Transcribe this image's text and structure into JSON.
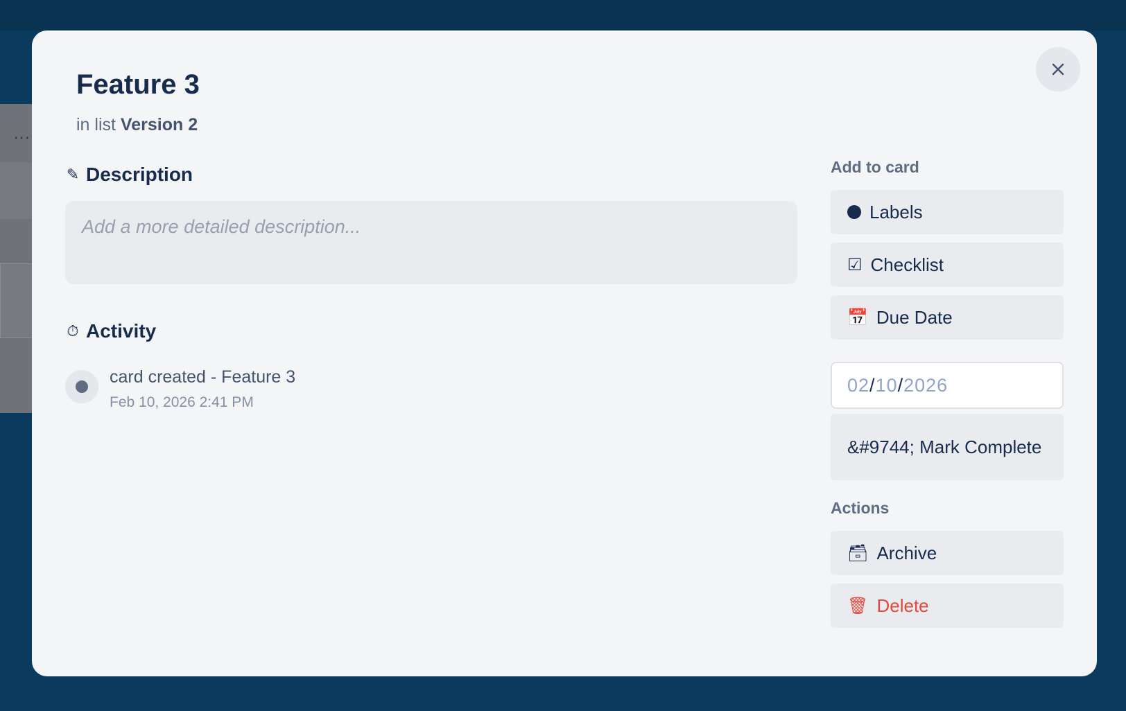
{
  "background": {
    "dots": "..."
  },
  "modal": {
    "title": "Feature 3",
    "subtitle_prefix": "in list",
    "list_name": "Version 2",
    "close_icon": "close-icon"
  },
  "description": {
    "heading": "Description",
    "icon": "pencil-icon",
    "placeholder": "Add a more detailed description..."
  },
  "activity": {
    "heading": "Activity",
    "icon": "stopwatch-icon",
    "items": [
      {
        "text": "card created - Feature 3",
        "time": "Feb 10, 2026 2:41 PM"
      }
    ]
  },
  "sidebar": {
    "add_heading": "Add to card",
    "labels_label": "Labels",
    "checklist_label": "Checklist",
    "checklist_icon": "☑",
    "due_date_label": "Due Date",
    "due_date_icon": "📅",
    "date_value": {
      "month": "02",
      "day": "10",
      "year": "2026",
      "sep": "/"
    },
    "mark_complete_label": "&#9744; Mark Complete",
    "actions_heading": "Actions",
    "archive_label": "Archive",
    "archive_icon": "🗃",
    "delete_label": "Delete",
    "delete_icon": "🗑"
  },
  "colors": {
    "backdrop": "#0a3a5e",
    "modal_bg": "#f3f5f7",
    "button_bg": "#e9ebee",
    "text_primary": "#172b4d",
    "danger": "#e2483d"
  }
}
